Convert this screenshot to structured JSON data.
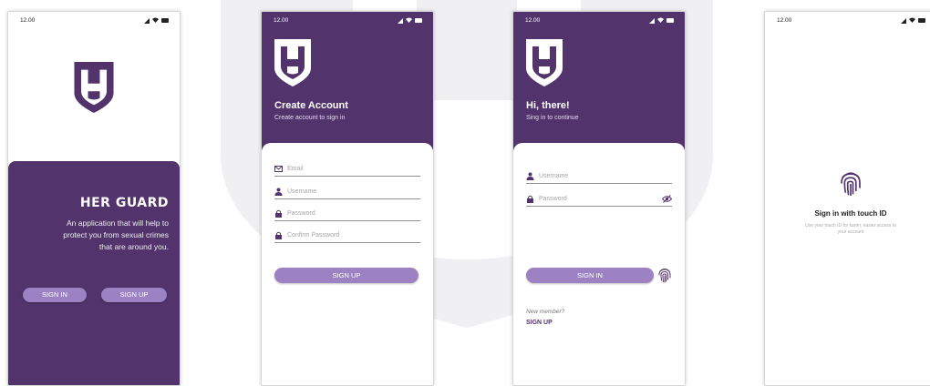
{
  "status_time": "12.00",
  "colors": {
    "primary": "#52336c",
    "button": "#9c82c3"
  },
  "splash": {
    "app_name": "HER GUARD",
    "description": "An application that will help to protect you from sexual crimes that are around you.",
    "signin_label": "SIGN IN",
    "signup_label": "SIGN UP"
  },
  "create_account": {
    "title": "Create Account",
    "subtitle": "Create account to sign in",
    "fields": [
      {
        "icon": "mail-icon",
        "placeholder": "Email"
      },
      {
        "icon": "user-icon",
        "placeholder": "Username"
      },
      {
        "icon": "lock-icon",
        "placeholder": "Password"
      },
      {
        "icon": "lock-icon",
        "placeholder": "Confirm Password"
      }
    ],
    "signup_label": "SIGN UP"
  },
  "sign_in": {
    "title": "Hi, there!",
    "subtitle": "Sing in to continue",
    "fields": [
      {
        "icon": "user-icon",
        "placeholder": "Username"
      },
      {
        "icon": "lock-icon",
        "placeholder": "Password"
      }
    ],
    "signin_label": "SIGN IN",
    "new_member": "New member?",
    "signup_link": "SIGN UP"
  },
  "touch_id": {
    "title": "Sign in with touch ID",
    "subtitle": "Use your touch ID for faster, easier access to your account"
  }
}
